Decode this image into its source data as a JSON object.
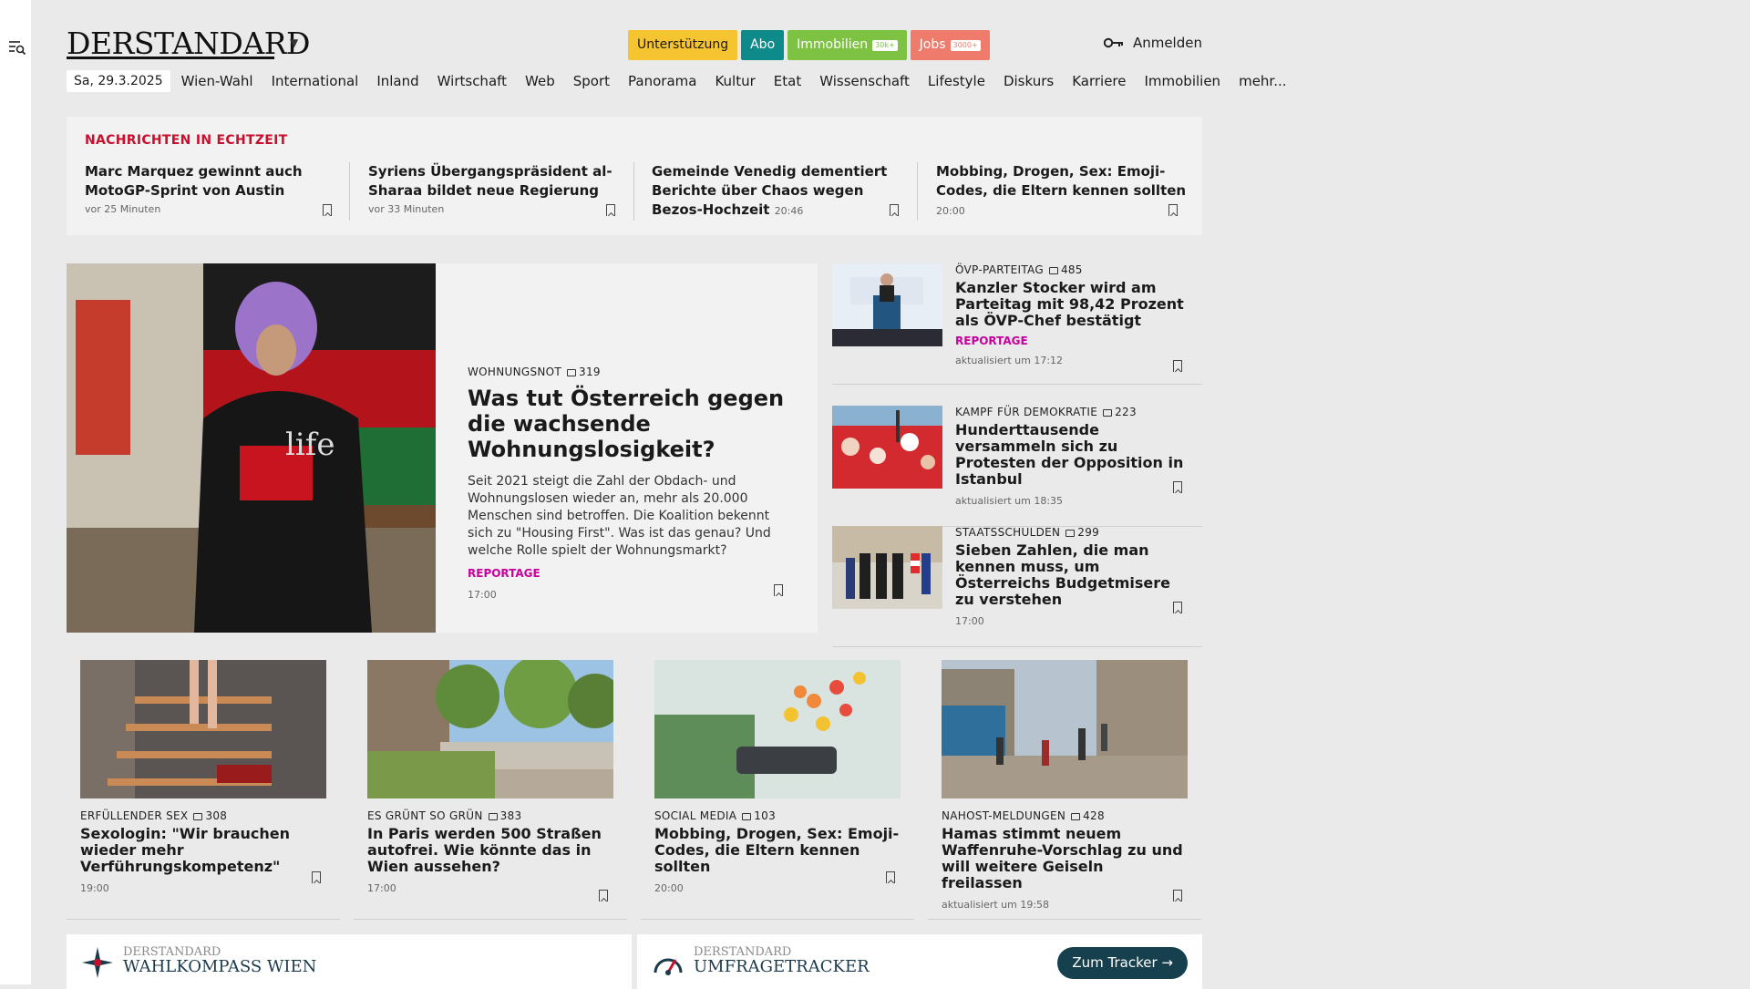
{
  "header": {
    "logo_text": "DERSTANDARD",
    "pills": [
      {
        "label": "Unterstützung",
        "bg": "#f6c431",
        "fg": "#1a1a1a",
        "tag": ""
      },
      {
        "label": "Abo",
        "bg": "#0e8a8a",
        "fg": "#ffffff",
        "tag": ""
      },
      {
        "label": "Immobilien",
        "bg": "#7dc242",
        "fg": "#ffffff",
        "tag": "30k+"
      },
      {
        "label": "Jobs",
        "bg": "#ef7b6c",
        "fg": "#ffffff",
        "tag": "3000+"
      }
    ],
    "login_label": "Anmelden"
  },
  "nav": {
    "date": "Sa, 29.3.2025",
    "items": [
      "Wien-Wahl",
      "International",
      "Inland",
      "Wirtschaft",
      "Web",
      "Sport",
      "Panorama",
      "Kultur",
      "Etat",
      "Wissenschaft",
      "Lifestyle",
      "Diskurs",
      "Karriere",
      "Immobilien",
      "mehr..."
    ]
  },
  "live": {
    "heading": "NACHRICHTEN IN ECHTZEIT",
    "items": [
      {
        "title": "Marc Marquez gewinnt auch MotoGP-Sprint von Austin",
        "inline_time": "",
        "meta": "vor 25 Minuten"
      },
      {
        "title": "Syriens Übergangspräsident al-Sharaa bildet neue Regierung",
        "inline_time": "",
        "meta": "vor 33 Minuten"
      },
      {
        "title": "Gemeinde Venedig dementiert Berichte über Chaos wegen Bezos-Hochzeit",
        "inline_time": "20:46",
        "meta": ""
      },
      {
        "title": "Mobbing, Drogen, Sex: Emoji-Codes, die Eltern kennen sollten",
        "inline_time": "20:00",
        "meta": ""
      }
    ]
  },
  "lead": {
    "kicker": "WOHNUNGSNOT",
    "comments": "319",
    "title": "Was tut Österreich gegen die wachsende Wohnungslosigkeit?",
    "teaser": "Seit 2021 steigt die Zahl der Obdach- und Wohnungslosen wieder an, mehr als 20.000 Menschen sind betroffen. Die Koalition bekennt sich zu \"Housing First\". Was ist das genau? Und welche Rolle spielt der Wohnungsmarkt?",
    "label": "REPORTAGE",
    "time": "17:00"
  },
  "side": [
    {
      "kicker": "ÖVP-PARTEITAG",
      "comments": "485",
      "title": "Kanzler Stocker wird am Parteitag mit 98,42 Prozent als ÖVP-Chef bestätigt",
      "label": "REPORTAGE",
      "time": "aktualisiert um 17:12"
    },
    {
      "kicker": "KAMPF FÜR DEMOKRATIE",
      "comments": "223",
      "title": "Hunderttausende versammeln sich zu Protesten der Opposition in Istanbul",
      "label": "",
      "time": "aktualisiert um 18:35"
    },
    {
      "kicker": "STAATSSCHULDEN",
      "comments": "299",
      "title": "Sieben Zahlen, die man kennen muss, um Österreichs Budgetmisere zu verstehen",
      "label": "",
      "time": "17:00"
    }
  ],
  "cards": [
    {
      "kicker": "ERFÜLLENDER SEX",
      "comments": "308",
      "title": "Sexologin: \"Wir brauchen wieder mehr Verführungskompetenz\"",
      "time": "19:00"
    },
    {
      "kicker": "ES GRÜNT SO GRÜN",
      "comments": "383",
      "title": "In Paris werden 500 Straßen autofrei. Wie könnte das in Wien aussehen?",
      "time": "17:00"
    },
    {
      "kicker": "SOCIAL MEDIA",
      "comments": "103",
      "title": "Mobbing, Drogen, Sex: Emoji-Codes, die Eltern kennen sollten",
      "time": "20:00"
    },
    {
      "kicker": "NAHOST-MELDUNGEN",
      "comments": "428",
      "title": "Hamas stimmt neuem Waffenruhe-Vorschlag zu und will weitere Geiseln freilassen",
      "time": "aktualisiert um 19:58"
    }
  ],
  "promos": [
    {
      "small": "DERSTANDARD",
      "big": "WAHLKOMPASS WIEN"
    },
    {
      "small": "DERSTANDARD",
      "big": "UMFRAGETRACKER",
      "button": "Zum Tracker"
    }
  ],
  "icons": [
    "menu-search-icon",
    "chevron-down-icon",
    "key-icon",
    "comment-icon",
    "bookmark-icon",
    "compass-icon",
    "arrow-right-icon"
  ]
}
